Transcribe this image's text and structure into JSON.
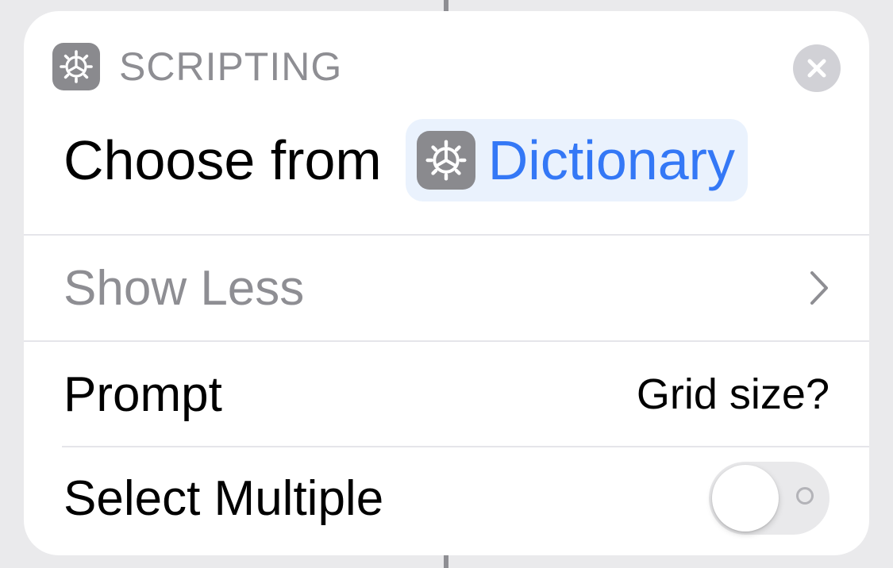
{
  "action": {
    "category": "SCRIPTING",
    "category_icon": "gear-icon",
    "title": "Choose from",
    "variable": {
      "label": "Dictionary",
      "icon": "gear-icon",
      "color": "#3478f6"
    }
  },
  "options": {
    "show_less": "Show Less",
    "prompt": {
      "label": "Prompt",
      "value": "Grid size?"
    },
    "select_multiple": {
      "label": "Select Multiple",
      "enabled": false
    }
  },
  "colors": {
    "accent": "#3478f6",
    "secondary_text": "#8e8e93",
    "icon_background": "#8a8a8e"
  }
}
